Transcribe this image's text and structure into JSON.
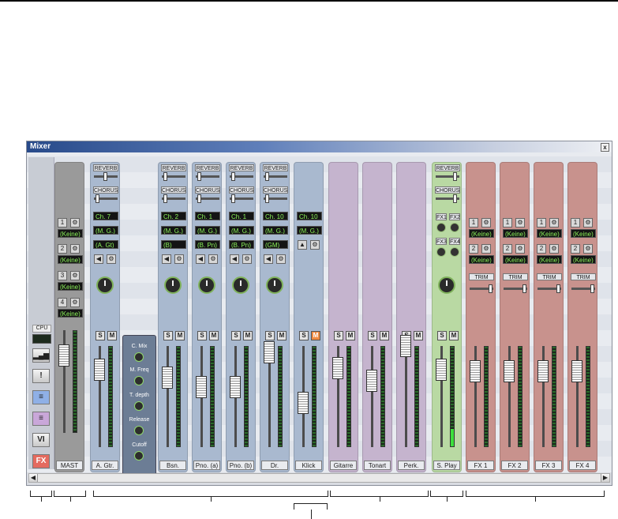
{
  "window": {
    "title": "Mixer",
    "close": "x"
  },
  "sidebar": {
    "cpu_label": "CPU",
    "buttons": [
      "",
      "!",
      "",
      "",
      "VI",
      "FX"
    ]
  },
  "master": {
    "name": "MAST",
    "sends": [
      {
        "num": "1",
        "value": "(Keine)"
      },
      {
        "num": "2",
        "value": "(Keine)"
      },
      {
        "num": "3",
        "value": "(Keine)"
      },
      {
        "num": "4",
        "value": "(Keine)"
      }
    ]
  },
  "labels": {
    "reverb": "REVERB",
    "chorus": "CHORUS",
    "solo": "S",
    "mute": "M",
    "trim": "TRIM"
  },
  "instrument_strips": [
    {
      "name": "A. Gtr.",
      "channel": "Ch. 7",
      "bank": "(M. G.)",
      "program": "(A. Gt)"
    },
    {
      "name": "Bsn.",
      "channel": "Ch. 2",
      "bank": "(M. G.)",
      "program": "(B)"
    },
    {
      "name": "Pno. (a)",
      "channel": "Ch. 1",
      "bank": "(M. G.)",
      "program": "(B. Pn)"
    },
    {
      "name": "Pno. (b)",
      "channel": "Ch. 1",
      "bank": "(M. G.)",
      "program": "(B. Pn)"
    },
    {
      "name": "Dr.",
      "channel": "Ch. 10",
      "bank": "(M. G.)",
      "program": "(GM)"
    },
    {
      "name": "Klick",
      "channel": "Ch. 10",
      "bank": "(M. G.)",
      "program": ""
    }
  ],
  "popup": {
    "params": [
      "C. Mix",
      "M. Freq",
      "T. depth",
      "Release",
      "Cutoff"
    ]
  },
  "audio_strips": [
    {
      "name": "Gitarre"
    },
    {
      "name": "Tonart"
    },
    {
      "name": "Perk."
    }
  ],
  "splay": {
    "name": "S. Play",
    "fx_labels": [
      "FX1",
      "FX2",
      "FX3",
      "FX4"
    ]
  },
  "fx_strips": [
    {
      "name": "FX 1",
      "sends": [
        "(Keine)",
        "(Keine)"
      ]
    },
    {
      "name": "FX 2",
      "sends": [
        "(Keine)",
        "(Keine)"
      ]
    },
    {
      "name": "FX 3",
      "sends": [
        "(Keine)",
        "(Keine)"
      ]
    },
    {
      "name": "FX 4",
      "sends": [
        "(Keine)",
        "(Keine)"
      ]
    }
  ],
  "colors": {
    "instrument": "#a9b9cf",
    "audio": "#c5b4ce",
    "splay": "#b9d9a3",
    "fx": "#c8928d",
    "lcd_text": "#8cf55a",
    "mute_on": "#f08a40"
  }
}
